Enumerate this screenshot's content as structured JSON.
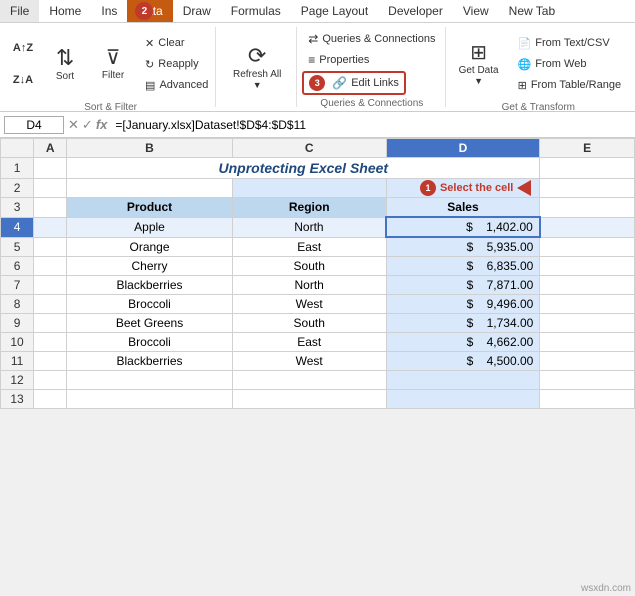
{
  "ribbon": {
    "tabs": [
      "File",
      "Home",
      "Ins",
      "Data",
      "Draw",
      "Formulas",
      "Page Layout",
      "Developer",
      "View",
      "New Tab"
    ],
    "active_tab": "Data",
    "groups": {
      "sort_filter": {
        "label": "Sort & Filter",
        "sort_btn": "Sort",
        "filter_btn": "Filter",
        "clear_btn": "Clear",
        "reapply_btn": "Reapply",
        "advanced_btn": "Advanced"
      },
      "queries": {
        "label": "Queries & Connections",
        "queries_connections_btn": "Queries & Connections",
        "properties_btn": "Properties",
        "edit_links_btn": "Edit Links",
        "refresh_btn": "Refresh All"
      },
      "get_data": {
        "label": "Get & Transform",
        "get_data_btn": "Get Data",
        "from_text_csv": "From Text/CSV",
        "from_web": "From Web",
        "from_table": "From Table/Range"
      }
    }
  },
  "formula_bar": {
    "cell_ref": "D4",
    "formula": "=[January.xlsx]Dataset!$D$4:$D$11"
  },
  "sheet": {
    "title": "Unprotecting Excel Sheet",
    "annotation": "Select the cell",
    "badge1": "1",
    "badge2": "2",
    "badge3": "3",
    "cols": [
      "",
      "A",
      "B",
      "C",
      "D",
      "E"
    ],
    "rows": [
      {
        "row": "1",
        "cells": [
          "",
          "",
          "",
          "",
          ""
        ]
      },
      {
        "row": "2",
        "cells": [
          "",
          "",
          "",
          "",
          ""
        ]
      },
      {
        "row": "3",
        "cells": [
          "",
          "Product",
          "Region",
          "Sales",
          ""
        ]
      },
      {
        "row": "4",
        "cells": [
          "",
          "Apple",
          "North",
          "$ 1,402.00",
          ""
        ]
      },
      {
        "row": "5",
        "cells": [
          "",
          "Orange",
          "East",
          "$ 5,935.00",
          ""
        ]
      },
      {
        "row": "6",
        "cells": [
          "",
          "Cherry",
          "South",
          "$ 6,835.00",
          ""
        ]
      },
      {
        "row": "7",
        "cells": [
          "",
          "Blackberries",
          "North",
          "$ 7,871.00",
          ""
        ]
      },
      {
        "row": "8",
        "cells": [
          "",
          "Broccoli",
          "West",
          "$ 9,496.00",
          ""
        ]
      },
      {
        "row": "9",
        "cells": [
          "",
          "Beet Greens",
          "South",
          "$ 1,734.00",
          ""
        ]
      },
      {
        "row": "10",
        "cells": [
          "",
          "Broccoli",
          "East",
          "$ 4,662.00",
          ""
        ]
      },
      {
        "row": "11",
        "cells": [
          "",
          "Blackberries",
          "West",
          "$ 4,500.00",
          ""
        ]
      },
      {
        "row": "12",
        "cells": [
          "",
          "",
          "",
          "",
          ""
        ]
      },
      {
        "row": "13",
        "cells": [
          "",
          "",
          "",
          "",
          ""
        ]
      }
    ]
  },
  "watermark": "wsxdn.com"
}
